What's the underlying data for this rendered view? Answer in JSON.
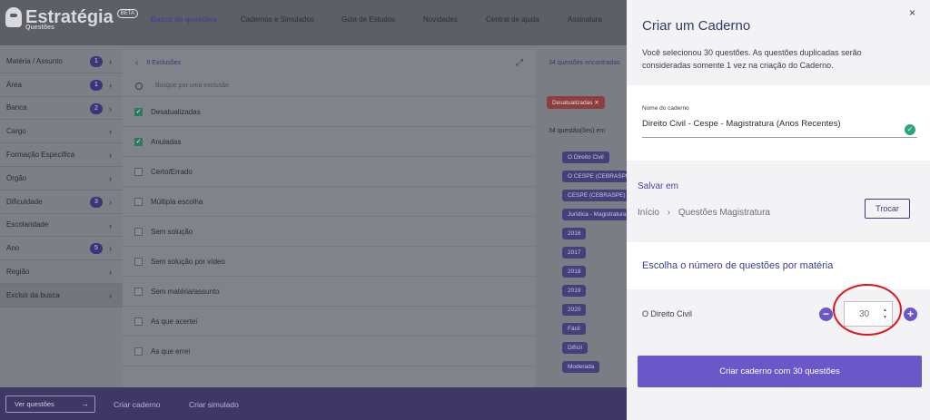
{
  "brand": {
    "name": "Estratégia",
    "sub": "Questões",
    "badge": "BETA"
  },
  "nav": [
    "Busca de questões",
    "Cadernos e Simulados",
    "Guia de Estudos",
    "Novidades",
    "Central de ajuda",
    "Assinatura"
  ],
  "sidebar": [
    {
      "label": "Matéria / Assunto",
      "count": "1"
    },
    {
      "label": "Área",
      "count": "1"
    },
    {
      "label": "Banca",
      "count": "2"
    },
    {
      "label": "Cargo",
      "count": ""
    },
    {
      "label": "Formação Específica",
      "count": ""
    },
    {
      "label": "Órgão",
      "count": ""
    },
    {
      "label": "Dificuldade",
      "count": "3"
    },
    {
      "label": "Escolaridade",
      "count": ""
    },
    {
      "label": "Ano",
      "count": "5"
    },
    {
      "label": "Região",
      "count": ""
    },
    {
      "label": "Excluir da busca",
      "count": ""
    }
  ],
  "exclusions": {
    "header": "9 Exclusões",
    "search_placeholder": "Busque por uma exclusão",
    "options": [
      {
        "label": "Desatualizadas",
        "checked": true
      },
      {
        "label": "Anuladas",
        "checked": true
      },
      {
        "label": "Certo/Errado",
        "checked": false
      },
      {
        "label": "Múltipla escolha",
        "checked": false
      },
      {
        "label": "Sem solução",
        "checked": false
      },
      {
        "label": "Sem solução por vídeo",
        "checked": false
      },
      {
        "label": "Sem matéria/assunto",
        "checked": false
      },
      {
        "label": "As que acertei",
        "checked": false
      },
      {
        "label": "As que errei",
        "checked": false
      }
    ]
  },
  "results": {
    "found": "34 questões encontradas",
    "in": "34 questão(ões) em",
    "red_tag": "Desatualizadas",
    "tags": [
      "O Direito Civil",
      "O CESPE (CEBRASPE)",
      "CESPE (CEBRASPE)",
      "Jurídica - Magistratura",
      "2016",
      "2017",
      "2018",
      "2019",
      "2020",
      "Fácil",
      "Difícil",
      "Moderada"
    ]
  },
  "bottom": {
    "view": "Ver questões",
    "create_notebook": "Criar caderno",
    "create_sim": "Criar simulado"
  },
  "panel": {
    "title": "Criar um Caderno",
    "description": "Você selecionou 30 questões. As questões duplicadas serão consideradas somente 1 vez na criação do Caderno.",
    "name_label": "Nome do caderno",
    "name_value": "Direito Civil - Cespe - Magistratura (Anos Recentes)",
    "save_in": "Salvar em",
    "crumb_root": "Início",
    "crumb_leaf": "Questões Magistratura",
    "change": "Trocar",
    "choose": "Escolha o número de questões por matéria",
    "subject": "O Direito Civil",
    "quantity": "30",
    "cta": "Criar caderno com 30 questões",
    "close": "×"
  },
  "colors": {
    "accent": "#6a57c8",
    "success": "#2aa57d",
    "highlight_ring": "#e1141c"
  }
}
